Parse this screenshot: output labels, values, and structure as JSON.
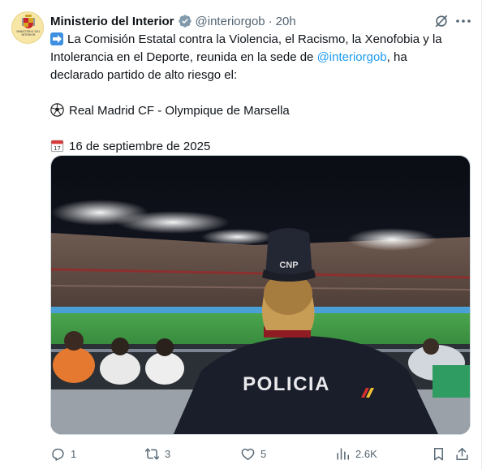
{
  "tweet": {
    "avatar_text": "MINISTERIO DEL INTERIOR",
    "display_name": "Ministerio del Interior",
    "handle": "@interiorgob",
    "separator": "·",
    "time": "20h",
    "body": {
      "line1_pre": "La Comisión Estatal contra la Violencia, el Racismo, la Xenofobia y la",
      "line2_pre": "Intolerancia en el Deporte, reunida en la sede de ",
      "line2_mention": "@interiorgob",
      "line2_post": ", ha",
      "line3": "declarado partido de alto riesgo el:",
      "match": "Real Madrid CF - Olympique de Marsella",
      "date": "16 de septiembre de 2025",
      "calendar_day": "17"
    },
    "photo": {
      "vest_text": "POLICIA",
      "cap_text": "CNP"
    },
    "actions": {
      "replies": "1",
      "reposts": "3",
      "likes": "5",
      "views": "2.6K"
    }
  },
  "colors": {
    "accent": "#1d9bf0",
    "text": "#0f1419",
    "muted": "#536471",
    "verified_badge": "#829aab"
  },
  "icons": [
    "verified-badge-icon",
    "grok-icon",
    "more-icon",
    "arrow-right-emoji",
    "soccer-ball-emoji",
    "calendar-emoji",
    "reply-icon",
    "repost-icon",
    "like-icon",
    "views-icon",
    "bookmark-icon",
    "share-icon"
  ]
}
